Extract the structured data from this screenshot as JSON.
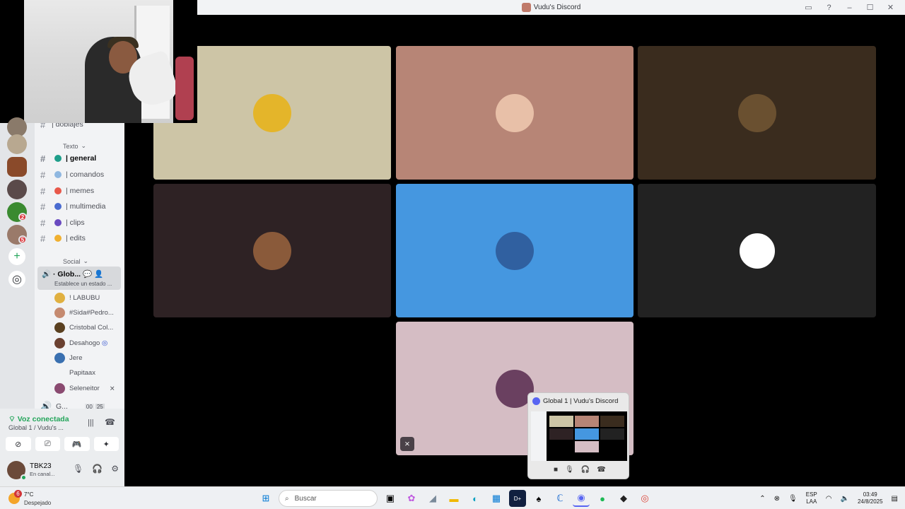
{
  "window": {
    "title": "Vudu's Discord"
  },
  "rail": {
    "badges": [
      "2",
      "5"
    ]
  },
  "channels": {
    "top_partial": "| doblajes",
    "text_category": "Texto",
    "text_channels": [
      {
        "label": "| general",
        "color": "#1e9e8a"
      },
      {
        "label": "| comandos",
        "color": "#8fb7e0"
      },
      {
        "label": "| memes",
        "color": "#e8584a"
      },
      {
        "label": "| multimedia",
        "color": "#4a6bd0"
      },
      {
        "label": "| clips",
        "color": "#6a4ac0"
      },
      {
        "label": "| edits",
        "color": "#f0b030"
      }
    ],
    "social_category": "Social",
    "voice_channel": {
      "label": "Glob...",
      "status": "Establece un estado ..."
    },
    "voice_users": [
      {
        "name": "! LABUBU",
        "color": "#e0b040"
      },
      {
        "name": "#Sida#Pedro...",
        "color": "#c58a70"
      },
      {
        "name": "Cristobal Col...",
        "color": "#5a4020"
      },
      {
        "name": "Desahogo",
        "color": "#6a4030"
      },
      {
        "name": "Jere",
        "color": "#3a70b0"
      },
      {
        "name": "Papitaax",
        "color": "#f2f3f5"
      },
      {
        "name": "Seleneitor",
        "color": "#8a4a70"
      }
    ],
    "next_voice": {
      "label": "G...",
      "count_a": "00",
      "count_b": "25"
    }
  },
  "voice_panel": {
    "connected": "Voz conectada",
    "channel": "Global 1 / Vudu's ...",
    "user_name": "TBK23",
    "user_status": "En canal..."
  },
  "tiles": [
    {
      "bg": "#cdc5a6",
      "avatar": "#e4b52a"
    },
    {
      "bg": "#b78576",
      "avatar": "#e8c0a8"
    },
    {
      "bg": "#3a2c1e",
      "avatar": "#6a5030"
    },
    {
      "bg": "#2e2224",
      "avatar": "#8a5a3a"
    },
    {
      "bg": "#4597e0",
      "avatar": "#3060a0"
    },
    {
      "bg": "#222222",
      "avatar": "#ffffff"
    },
    {
      "bg": "#d5bdc4",
      "avatar": "#6a4060"
    }
  ],
  "popup": {
    "title": "Global 1 | Vudu's Discord"
  },
  "taskbar": {
    "temp": "7°C",
    "condition": "Despejado",
    "weather_badge": "6",
    "search": "Buscar",
    "lang1": "ESP",
    "lang2": "LAA",
    "time": "03:49",
    "date": "24/8/2025"
  }
}
